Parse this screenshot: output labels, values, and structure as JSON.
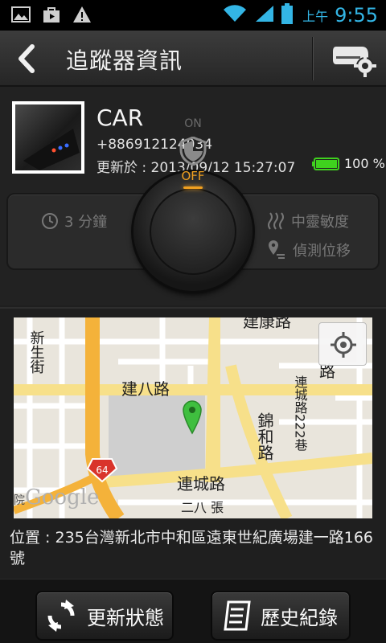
{
  "status_bar": {
    "left_icons": [
      "image-icon",
      "bag-icon",
      "warning-icon"
    ],
    "right_icons": [
      "wifi-icon",
      "signal-icon",
      "battery-icon"
    ],
    "ampm": "上午",
    "time": "9:55",
    "accent_color": "#33b5e5"
  },
  "header": {
    "back_icon": "chevron-left-icon",
    "title": "追蹤器資訊",
    "settings_icon": "device-settings-icon"
  },
  "device": {
    "name": "CAR",
    "phone": "+886912124034",
    "updated": "更新於 : 2013/09/12 15:27:07",
    "battery_percent": "100 %",
    "battery_level": 1.0,
    "battery_color": "#3fd21e"
  },
  "controls": {
    "interval": "3 分鐘",
    "power_on_label": "ON",
    "power_off_label": "OFF",
    "off_color": "#f0a020",
    "sensitivity": "中靈敏度",
    "detect_movement": "偵測位移"
  },
  "map": {
    "streets": [
      "建康路",
      "新生街",
      "建八路",
      "路",
      "錦和路",
      "連城路222巷",
      "連城路",
      "二八 張"
    ],
    "highway_shield": "64",
    "provider": "Google",
    "partial_label": "院",
    "pin_color": "#3fbf3f",
    "locate_icon": "crosshair-icon"
  },
  "address": "位置 : 235台灣新北市中和區遠東世紀廣場建一路166號",
  "buttons": {
    "refresh": "更新狀態",
    "history": "歷史紀錄"
  }
}
